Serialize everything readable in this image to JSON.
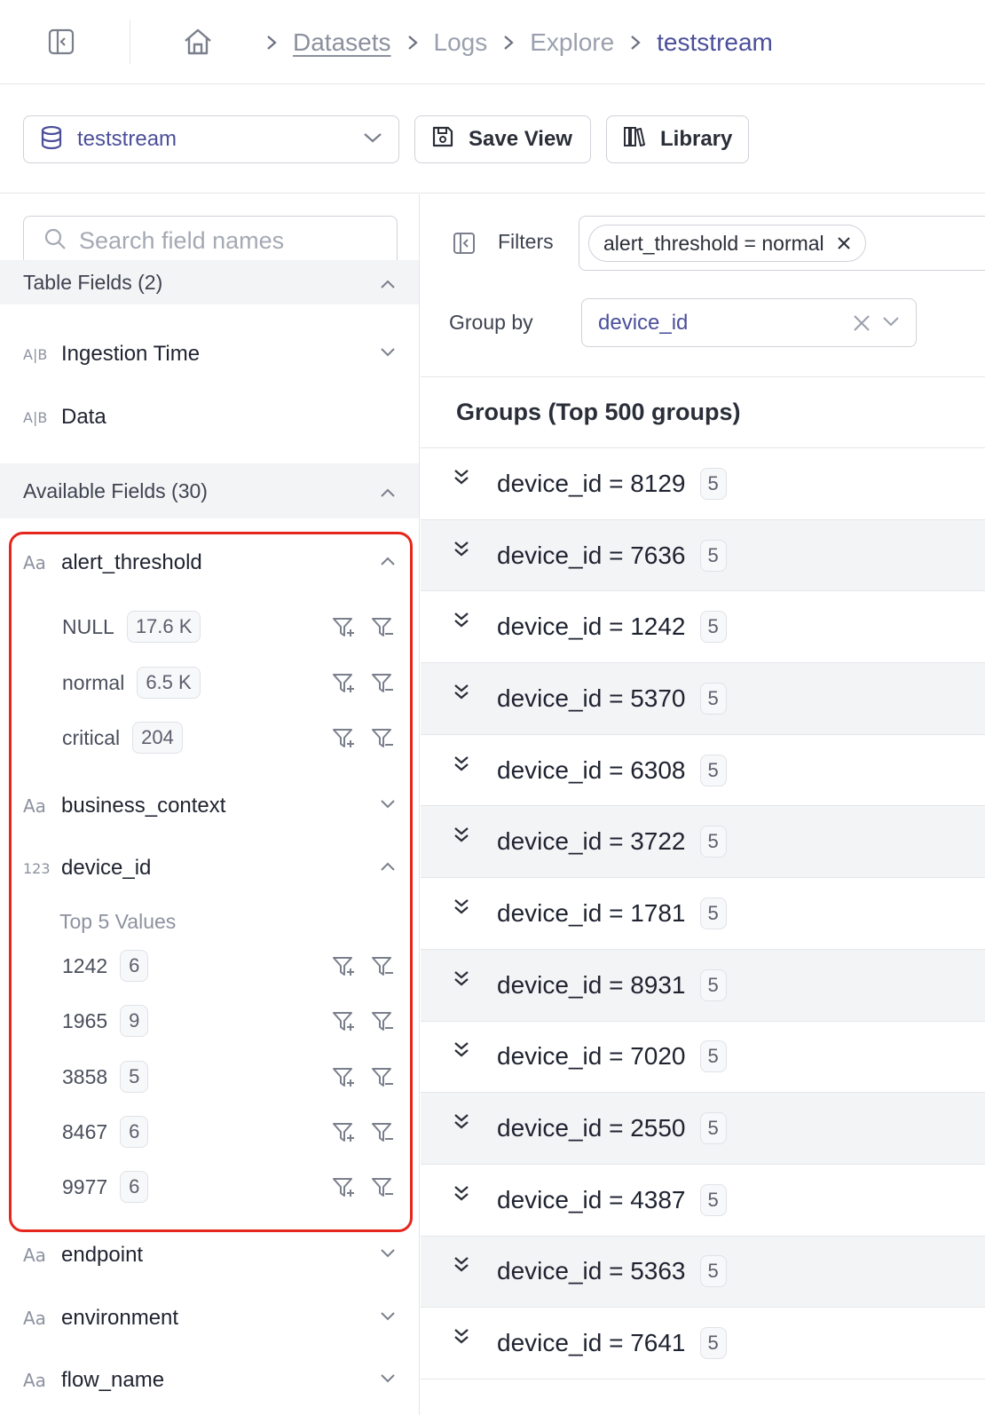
{
  "breadcrumb": {
    "items": [
      "Datasets",
      "Logs",
      "Explore",
      "teststream"
    ]
  },
  "toolbar": {
    "stream": "teststream",
    "save_label": "Save View",
    "library_label": "Library"
  },
  "sidebar": {
    "search_placeholder": "Search field names",
    "table_fields_title": "Table Fields (2)",
    "table_fields": [
      {
        "type": "A|B",
        "name": "Ingestion Time"
      },
      {
        "type": "A|B",
        "name": "Data"
      }
    ],
    "available_fields_title": "Available Fields (30)",
    "alert_threshold": {
      "type": "Aa",
      "name": "alert_threshold",
      "values": [
        {
          "label": "NULL",
          "count": "17.6 K"
        },
        {
          "label": "normal",
          "count": "6.5 K"
        },
        {
          "label": "critical",
          "count": "204"
        }
      ]
    },
    "business_context": {
      "type": "Aa",
      "name": "business_context"
    },
    "device_id": {
      "type": "123",
      "name": "device_id",
      "top_label": "Top 5 Values",
      "values": [
        {
          "label": "1242",
          "count": "6"
        },
        {
          "label": "1965",
          "count": "9"
        },
        {
          "label": "3858",
          "count": "5"
        },
        {
          "label": "8467",
          "count": "6"
        },
        {
          "label": "9977",
          "count": "6"
        }
      ]
    },
    "more_fields": [
      {
        "type": "Aa",
        "name": "endpoint"
      },
      {
        "type": "Aa",
        "name": "environment"
      },
      {
        "type": "Aa",
        "name": "flow_name"
      }
    ]
  },
  "main": {
    "filters_label": "Filters",
    "filter_chip": "alert_threshold = normal",
    "groupby_label": "Group by",
    "groupby_value": "device_id",
    "groups_title": "Groups (Top 500 groups)",
    "groups": [
      {
        "label": "device_id = 8129",
        "count": "5"
      },
      {
        "label": "device_id = 7636",
        "count": "5"
      },
      {
        "label": "device_id = 1242",
        "count": "5"
      },
      {
        "label": "device_id = 5370",
        "count": "5"
      },
      {
        "label": "device_id = 6308",
        "count": "5"
      },
      {
        "label": "device_id = 3722",
        "count": "5"
      },
      {
        "label": "device_id = 1781",
        "count": "5"
      },
      {
        "label": "device_id = 8931",
        "count": "5"
      },
      {
        "label": "device_id = 7020",
        "count": "5"
      },
      {
        "label": "device_id = 2550",
        "count": "5"
      },
      {
        "label": "device_id = 4387",
        "count": "5"
      },
      {
        "label": "device_id = 5363",
        "count": "5"
      },
      {
        "label": "device_id = 7641",
        "count": "5"
      }
    ]
  },
  "colors": {
    "accent": "#4b4f9a",
    "highlight_border": "#e6261c",
    "row_alt": "#f3f4f6"
  }
}
